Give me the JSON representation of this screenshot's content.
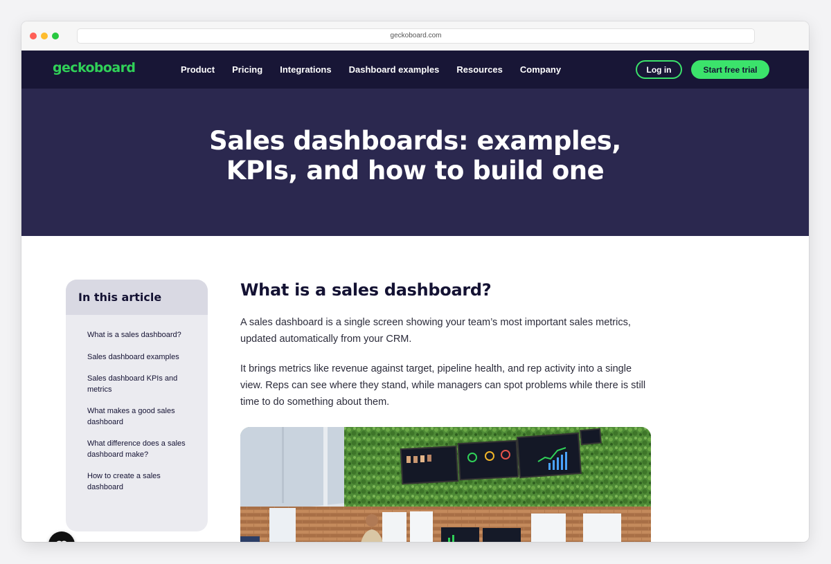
{
  "browser": {
    "url": "geckoboard.com"
  },
  "nav": {
    "logo": "geckoboard",
    "items": [
      "Product",
      "Pricing",
      "Integrations",
      "Dashboard examples",
      "Resources",
      "Company"
    ],
    "login": "Log in",
    "trial": "Start free trial"
  },
  "hero": {
    "title": "Sales dashboards: examples, KPIs, and how to build one"
  },
  "toc": {
    "title": "In this article",
    "items": [
      "What is a sales dashboard?",
      "Sales dashboard examples",
      "Sales dashboard KPIs and metrics",
      "What makes a good sales dashboard",
      "What difference does a sales dashboard make?",
      "How to create a sales dashboard"
    ]
  },
  "article": {
    "heading": "What is a sales dashboard?",
    "paragraphs": [
      "A sales dashboard is a single screen showing your team’s most important sales metrics, updated automatically from your CRM.",
      "It brings metrics like revenue against target, pipeline health, and rep activity into a single view. Reps can see where they stand, while managers can spot problems while there is still time to do something about them."
    ]
  },
  "colors": {
    "nav_bg": "#181636",
    "hero_bg": "#2b284f",
    "accent_green": "#3be36b",
    "text_dark": "#141233"
  }
}
